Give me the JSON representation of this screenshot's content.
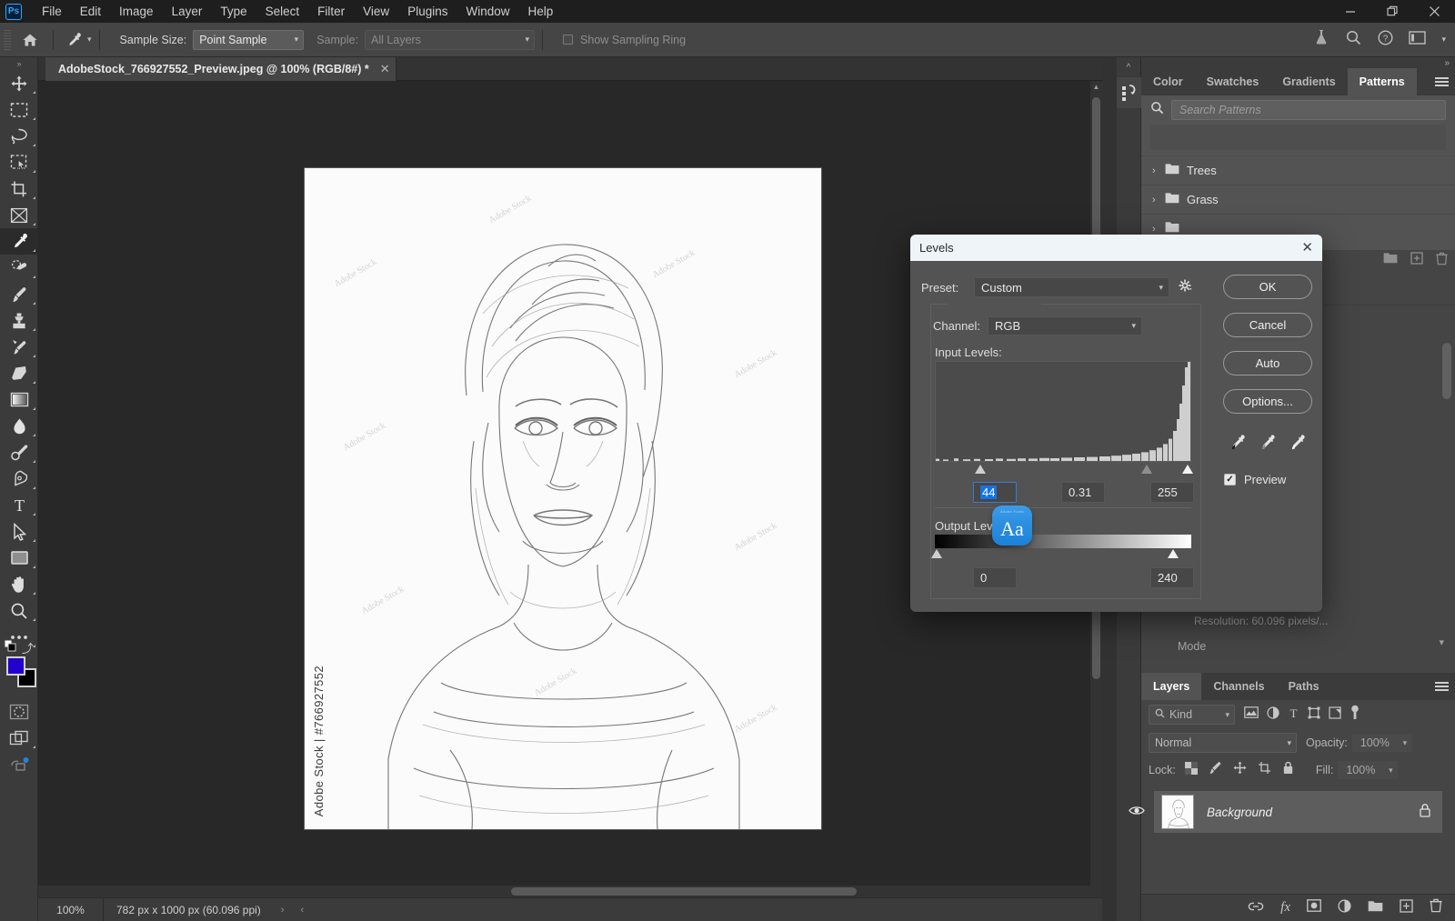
{
  "app": {
    "logo": "Ps",
    "menus": [
      "File",
      "Edit",
      "Image",
      "Layer",
      "Type",
      "Select",
      "Filter",
      "View",
      "Plugins",
      "Window",
      "Help"
    ],
    "window_controls": {
      "minimize": "—",
      "restore": "restore-icon",
      "close": "✕"
    }
  },
  "options_bar": {
    "home_icon": "home-icon",
    "tool_icon": "eyedropper-icon",
    "sample_size_label": "Sample Size:",
    "sample_size_value": "Point Sample",
    "sample_label": "Sample:",
    "sample_value": "All Layers",
    "show_sampling_ring_label": "Show Sampling Ring",
    "show_sampling_ring_checked": false,
    "right_icons": [
      "flask-icon",
      "search-icon",
      "help-icon",
      "workspace-icon"
    ]
  },
  "toolbar": {
    "tools": [
      {
        "name": "move-tool",
        "icon": "move"
      },
      {
        "name": "marquee-tool",
        "icon": "marquee"
      },
      {
        "name": "lasso-tool",
        "icon": "lasso"
      },
      {
        "name": "object-selection-tool",
        "icon": "object-select"
      },
      {
        "name": "crop-tool",
        "icon": "crop"
      },
      {
        "name": "frame-tool",
        "icon": "frame"
      },
      {
        "name": "eyedropper-tool",
        "icon": "eyedropper",
        "active": true
      },
      {
        "name": "healing-brush-tool",
        "icon": "healing"
      },
      {
        "name": "brush-tool",
        "icon": "brush"
      },
      {
        "name": "clone-stamp-tool",
        "icon": "stamp"
      },
      {
        "name": "history-brush-tool",
        "icon": "history-brush"
      },
      {
        "name": "eraser-tool",
        "icon": "eraser"
      },
      {
        "name": "gradient-tool",
        "icon": "gradient"
      },
      {
        "name": "blur-tool",
        "icon": "blur"
      },
      {
        "name": "dodge-tool",
        "icon": "dodge"
      },
      {
        "name": "pen-tool",
        "icon": "pen"
      },
      {
        "name": "type-tool",
        "icon": "type"
      },
      {
        "name": "path-selection-tool",
        "icon": "arrow"
      },
      {
        "name": "shape-tool",
        "icon": "rectangle"
      },
      {
        "name": "hand-tool",
        "icon": "hand"
      },
      {
        "name": "zoom-tool",
        "icon": "zoom"
      },
      {
        "name": "edit-toolbar-button",
        "icon": "ellipsis"
      }
    ],
    "foreground_color": "#2300cc",
    "background_color": "#000000",
    "quickmask_icon": "quick-mask-icon",
    "screenmode_icon": "screen-mode-icon"
  },
  "document": {
    "tab_title": "AdobeStock_766927552_Preview.jpeg @ 100% (RGB/8#) *",
    "close_label": "✕",
    "watermark_vertical": "Adobe Stock | #766927552",
    "watermark_tile": "Adobe Stock"
  },
  "status_bar": {
    "zoom": "100%",
    "dimensions": "782 px x 1000 px (60.096 ppi)",
    "expand_arrow": "›",
    "collapse_arrow": "‹"
  },
  "right_dock": {
    "collapse_left": "«",
    "collapse_right": "»",
    "history_icon": "actions-panel-icon",
    "top_tabs": [
      {
        "label": "Color",
        "active": false
      },
      {
        "label": "Swatches",
        "active": false
      },
      {
        "label": "Gradients",
        "active": false
      },
      {
        "label": "Patterns",
        "active": true
      }
    ],
    "menu_icon": "panel-menu-icon",
    "patterns": {
      "search_placeholder": "Search Patterns",
      "search_icon": "search-icon",
      "groups": [
        {
          "label": "Trees",
          "expanded": false
        },
        {
          "label": "Grass",
          "expanded": false
        }
      ]
    },
    "properties": {
      "resolution_text": "Resolution:  60.096  pixels/...",
      "mode_label": "Mode"
    },
    "layers": {
      "tabs": [
        {
          "label": "Layers",
          "active": true
        },
        {
          "label": "Channels",
          "active": false
        },
        {
          "label": "Paths",
          "active": false
        }
      ],
      "filter_label": "Kind",
      "filter_icons": [
        "pixel-filter-icon",
        "adjustment-filter-icon",
        "type-filter-icon",
        "shape-filter-icon",
        "smart-object-filter-icon",
        "filter-toggle-icon"
      ],
      "blend_mode": "Normal",
      "opacity_label": "Opacity:",
      "opacity_value": "100%",
      "lock_label": "Lock:",
      "lock_icons": [
        "lock-transparent-icon",
        "lock-image-icon",
        "lock-position-icon",
        "lock-artboard-icon",
        "lock-all-icon"
      ],
      "fill_label": "Fill:",
      "fill_value": "100%",
      "rows": [
        {
          "name": "Background",
          "visible": true,
          "locked": true
        }
      ],
      "bottom_icons": [
        "link-layers-icon",
        "layer-style-icon",
        "layer-mask-icon",
        "adjustment-layer-icon",
        "new-group-icon",
        "new-layer-icon",
        "delete-layer-icon"
      ],
      "fx_label": "fx"
    }
  },
  "levels_dialog": {
    "title": "Levels",
    "close_label": "✕",
    "preset_label": "Preset:",
    "preset_value": "Custom",
    "gear_icon": "preset-options-gear-icon",
    "channel_label": "Channel:",
    "channel_value": "RGB",
    "input_levels_label": "Input Levels:",
    "input_shadow": "44",
    "input_midtone": "0.31",
    "input_highlight": "255",
    "output_levels_label": "Output Lev",
    "output_levels_label_full": "Output Levels:",
    "output_black": "0",
    "output_white": "240",
    "buttons": [
      "OK",
      "Cancel",
      "Auto",
      "Options..."
    ],
    "eyedroppers": [
      "set-black-point-icon",
      "set-gray-point-icon",
      "set-white-point-icon"
    ],
    "preview_label": "Preview",
    "preview_checked": true,
    "overlay_icon_text": "Aa",
    "overlay_icon_sub": "Adobe  Fonts",
    "accent_color": "#1473e6",
    "titlebar_color": "#eef4f7"
  }
}
